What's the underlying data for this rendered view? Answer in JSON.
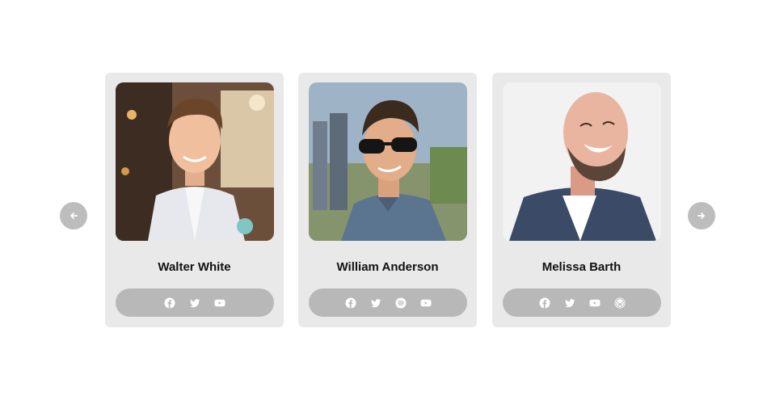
{
  "navigation": {
    "prev_icon": "arrow-left-icon",
    "next_icon": "arrow-right-icon"
  },
  "team": [
    {
      "name": "Walter White",
      "socials": [
        "facebook-icon",
        "twitter-icon",
        "youtube-icon"
      ]
    },
    {
      "name": "William Anderson",
      "socials": [
        "facebook-icon",
        "twitter-icon",
        "spotify-icon",
        "youtube-icon"
      ]
    },
    {
      "name": "Melissa Barth",
      "socials": [
        "facebook-icon",
        "twitter-icon",
        "youtube-icon",
        "wordpress-icon"
      ]
    }
  ],
  "colors": {
    "card_bg": "#e9e9e9",
    "social_bar_bg": "#b8b8b8",
    "nav_button_bg": "#bdbdbd",
    "icon_color": "#ffffff"
  }
}
